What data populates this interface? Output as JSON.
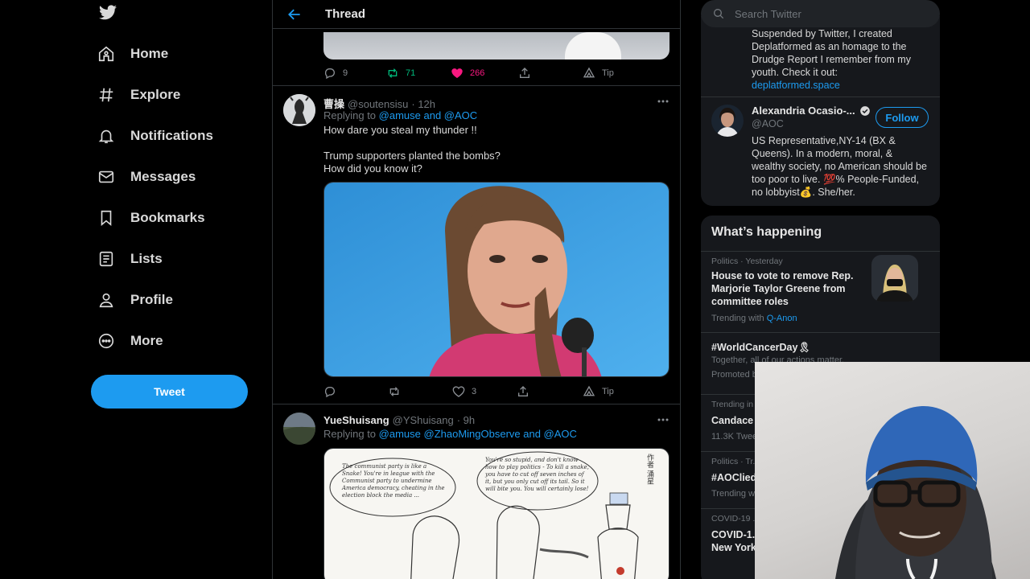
{
  "nav": {
    "items": [
      {
        "label": "Home",
        "icon": "home-icon"
      },
      {
        "label": "Explore",
        "icon": "hashtag-icon"
      },
      {
        "label": "Notifications",
        "icon": "bell-icon"
      },
      {
        "label": "Messages",
        "icon": "envelope-icon"
      },
      {
        "label": "Bookmarks",
        "icon": "bookmark-icon"
      },
      {
        "label": "Lists",
        "icon": "list-icon"
      },
      {
        "label": "Profile",
        "icon": "person-icon"
      },
      {
        "label": "More",
        "icon": "more-circle-icon"
      }
    ],
    "tweet_label": "Tweet"
  },
  "header": {
    "title": "Thread"
  },
  "top_actions": {
    "replies": "9",
    "retweets": "71",
    "likes": "266",
    "tip": "Tip"
  },
  "tweets": [
    {
      "name": "曹操",
      "handle": "@soutensisu",
      "time": "· 12h",
      "replying_prefix": "Replying to",
      "replying_links": "@amuse and @AOC",
      "text": "How dare you steal my thunder !!\n\nTrump supporters planted the bombs?\nHow did you know it?",
      "actions": {
        "replies": "",
        "retweets": "",
        "likes": "3",
        "tip": "Tip"
      }
    },
    {
      "name": "YueShuisang",
      "handle": "@YShuisang",
      "time": "· 9h",
      "replying_prefix": "Replying to",
      "replying_links": "@amuse @ZhaoMingObserve and @AOC",
      "cartoon": {
        "bubble_left": "The communist party is like a Snake! You're in league with the Communist party to undermine America democracy, cheating in the election block the media ...",
        "bubble_right": "You're so stupid, and don't know how to play politics - To kill a snake, you have to cut off seven inches of it, but you only cut off its tail. So it will bite you. You will certainly lose!",
        "signature": "作者 涌星"
      }
    }
  ],
  "search": {
    "placeholder": "Search Twitter"
  },
  "who_to_follow": {
    "partial_bio_lines": [
      "Suspended by Twitter, I created",
      "Deplatformed as an homage to the",
      "Drudge Report I remember from my",
      "youth. Check it out:"
    ],
    "partial_bio_link": "deplatformed.space",
    "account": {
      "name": "Alexandria Ocasio-...",
      "handle": "@AOC",
      "bio": "US Representative,NY-14 (BX & Queens). In a modern, moral, & wealthy society, no American should be too poor to live. 💯% People-Funded, no lobbyist💰. She/her.",
      "follow_label": "Follow"
    }
  },
  "trends": {
    "title": "What’s happening",
    "items": [
      {
        "meta": "Politics · Yesterday",
        "topic": "House to vote to remove Rep. Marjorie Taylor Greene from committee roles",
        "sub_prefix": "Trending with",
        "sub_link": "Q-Anon"
      },
      {
        "meta": "",
        "topic": "#WorldCancerDay🎗",
        "sub": "Together, all of our actions matter.",
        "promoted": "Promoted by ..."
      },
      {
        "meta": "Trending in ...",
        "topic": "Candace ...",
        "sub": "11.3K Tweets"
      },
      {
        "meta": "Politics · Tr...",
        "topic": "#AOClied",
        "sub": "Trending w..."
      },
      {
        "meta": "COVID-19 ...",
        "topic": "COVID-1...",
        "topic2": "New York..."
      }
    ]
  },
  "colors": {
    "accent": "#1d9bf0",
    "retweet": "#00ba7c",
    "like": "#f91880",
    "background": "#000000"
  }
}
